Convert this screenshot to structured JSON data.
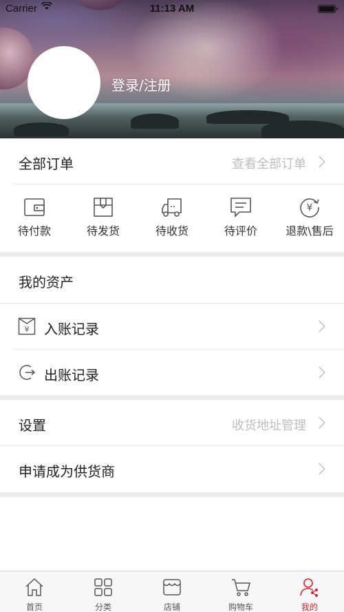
{
  "status_bar": {
    "carrier": "Carrier",
    "time": "11:13 AM",
    "wifi_icon": "wifi-icon",
    "battery_level": 1.0
  },
  "profile": {
    "login_label": "登录/注册"
  },
  "orders": {
    "title": "全部订单",
    "view_all": "查看全部订单",
    "items": [
      {
        "label": "待付款",
        "icon": "wallet-icon"
      },
      {
        "label": "待发货",
        "icon": "package-icon"
      },
      {
        "label": "待收货",
        "icon": "truck-icon"
      },
      {
        "label": "待评价",
        "icon": "comment-icon"
      },
      {
        "label": "退款\\售后",
        "icon": "refund-icon"
      }
    ]
  },
  "assets": {
    "title": "我的资产",
    "income_label": "入账记录",
    "outgoing_label": "出账记录"
  },
  "settings": {
    "title": "设置",
    "address_hint": "收货地址管理",
    "supplier_label": "申请成为供货商"
  },
  "tabbar": {
    "items": [
      {
        "label": "首页",
        "icon": "home-icon"
      },
      {
        "label": "分类",
        "icon": "category-icon"
      },
      {
        "label": "店铺",
        "icon": "shop-icon"
      },
      {
        "label": "购物车",
        "icon": "cart-icon"
      },
      {
        "label": "我的",
        "icon": "profile-icon"
      }
    ],
    "active_index": 4,
    "active_color": "#d9232d",
    "inactive_color": "#555555"
  }
}
